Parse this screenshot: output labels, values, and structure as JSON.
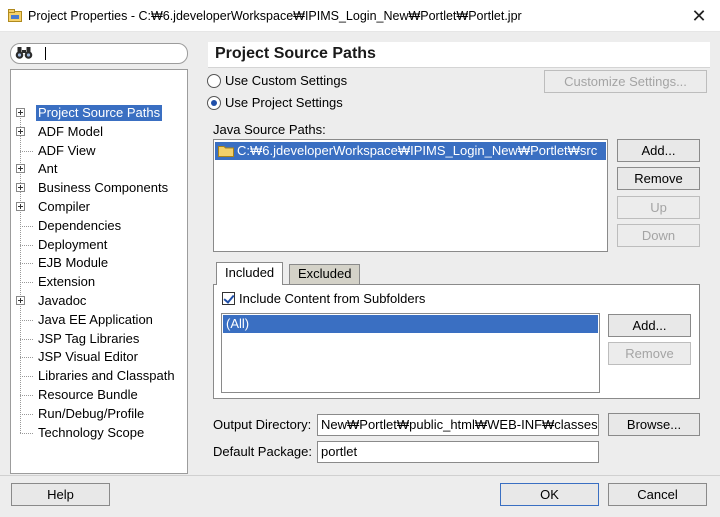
{
  "window": {
    "title": "Project Properties - C:₩6.jdeveloperWorkspace₩IPIMS_Login_New₩Portlet₩Portlet.jpr",
    "close_glyph": "✕"
  },
  "tree": {
    "items": [
      {
        "label": "Project Source Paths",
        "expandable": true,
        "selected": true
      },
      {
        "label": "ADF Model",
        "expandable": true
      },
      {
        "label": "ADF View",
        "expandable": false
      },
      {
        "label": "Ant",
        "expandable": true
      },
      {
        "label": "Business Components",
        "expandable": true
      },
      {
        "label": "Compiler",
        "expandable": true
      },
      {
        "label": "Dependencies",
        "expandable": false
      },
      {
        "label": "Deployment",
        "expandable": false
      },
      {
        "label": "EJB Module",
        "expandable": false
      },
      {
        "label": "Extension",
        "expandable": false
      },
      {
        "label": "Javadoc",
        "expandable": true
      },
      {
        "label": "Java EE Application",
        "expandable": false
      },
      {
        "label": "JSP Tag Libraries",
        "expandable": false
      },
      {
        "label": "JSP Visual Editor",
        "expandable": false
      },
      {
        "label": "Libraries and Classpath",
        "expandable": false
      },
      {
        "label": "Resource Bundle",
        "expandable": false
      },
      {
        "label": "Run/Debug/Profile",
        "expandable": false
      },
      {
        "label": "Technology Scope",
        "expandable": false
      }
    ]
  },
  "panel": {
    "header": "Project Source Paths",
    "use_custom_settings": "Use Custom Settings",
    "use_project_settings": "Use Project Settings",
    "customize_settings_button": "Customize Settings...",
    "java_source_paths_label": "Java Source Paths:",
    "source_paths": [
      "C:₩6.jdeveloperWorkspace₩IPIMS_Login_New₩Portlet₩src"
    ],
    "add_button": "Add...",
    "remove_button": "Remove",
    "up_button": "Up",
    "down_button": "Down",
    "tabs": [
      "Included",
      "Excluded"
    ],
    "include_subfolders_label": "Include Content from Subfolders",
    "included_items": [
      "(All)"
    ],
    "included_add_button": "Add...",
    "included_remove_button": "Remove",
    "output_directory_label": "Output Directory:",
    "output_directory_value": "New₩Portlet₩public_html₩WEB-INF₩classes",
    "browse_button": "Browse...",
    "default_package_label": "Default Package:",
    "default_package_value": "portlet"
  },
  "footer": {
    "help_button": "Help",
    "ok_button": "OK",
    "cancel_button": "Cancel"
  }
}
